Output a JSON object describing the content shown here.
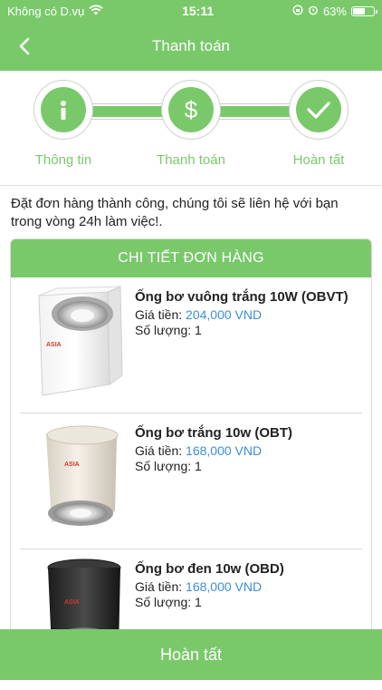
{
  "status_bar": {
    "carrier": "Không có D.vụ",
    "time": "15:11",
    "battery_text": "63%",
    "battery_level": 0.63
  },
  "header": {
    "title": "Thanh toán"
  },
  "steps": [
    {
      "label": "Thông tin",
      "icon": "info-icon"
    },
    {
      "label": "Thanh toán",
      "icon": "dollar-icon"
    },
    {
      "label": "Hoàn tất",
      "icon": "check-icon"
    }
  ],
  "message": "Đặt đơn hàng thành công, chúng tôi sẽ liên hệ với bạn trong vòng 24h làm việc!.",
  "order_detail": {
    "title": "CHI TIẾT ĐƠN HÀNG",
    "items": [
      {
        "name": "Ống bơ vuông trắng 10W (OBVT)",
        "price_label": "Giá tiền:",
        "price": "204,000 VND",
        "qty_label": "Số lượng:",
        "qty": "1",
        "thumb_brand": "ASIA"
      },
      {
        "name": "Ống bơ trắng 10w (OBT)",
        "price_label": "Giá tiền:",
        "price": "168,000 VND",
        "qty_label": "Số lượng:",
        "qty": "1",
        "thumb_brand": "ASIA"
      },
      {
        "name": "Ống bơ đen 10w (OBD)",
        "price_label": "Giá tiền:",
        "price": "168,000 VND",
        "qty_label": "Số lượng:",
        "qty": "1",
        "thumb_brand": "ASIA"
      }
    ]
  },
  "footer": {
    "button_label": "Hoàn tất"
  },
  "colors": {
    "accent": "#79c96a",
    "price": "#3a8ed8"
  }
}
